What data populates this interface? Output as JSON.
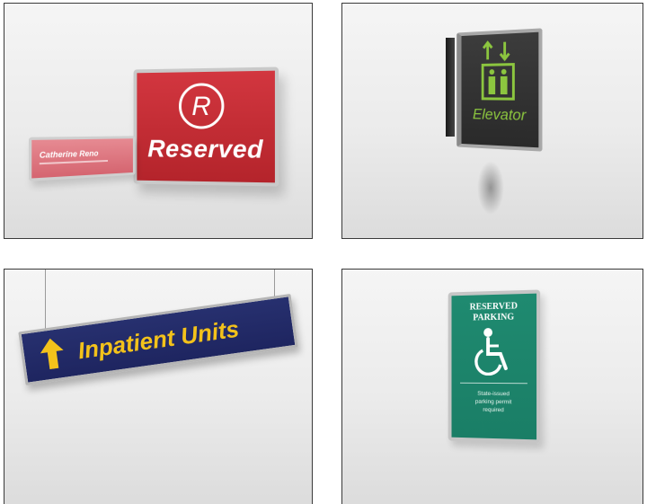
{
  "panels": [
    {
      "id": "reserved",
      "sign_text": "Reserved",
      "name_plate_text": "Catherine Reno",
      "sign_color": "#c52d35",
      "name_plate_color": "#e07b84"
    },
    {
      "id": "elevator",
      "sign_text": "Elevator",
      "sign_color": "#333333",
      "text_color": "#8cc63f",
      "icon": "elevator-icon"
    },
    {
      "id": "inpatient",
      "sign_text": "Inpatient Units",
      "sign_color": "#242c6a",
      "text_color": "#f3c21b",
      "icon": "arrow-up-icon"
    },
    {
      "id": "parking",
      "title_line1": "RESERVED",
      "title_line2": "PARKING",
      "body_line1": "State-issued",
      "body_line2": "parking permit",
      "body_line3": "required",
      "sign_color": "#1f8a70",
      "icon": "wheelchair-icon"
    }
  ]
}
